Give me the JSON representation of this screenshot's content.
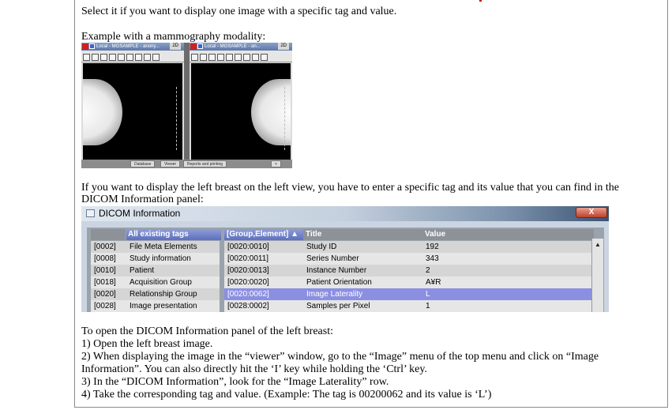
{
  "intro": "Select it if you want to display one image with a specific tag and value.",
  "example_label": "Example with a mammography modality:",
  "mammo_viewer": {
    "panes": [
      {
        "title": "Local - MGSAMPLE - anony...",
        "mode": "2D"
      },
      {
        "title": "Local - MGSAMPLE - an...",
        "mode": "2D"
      }
    ],
    "bottom_buttons": [
      "Database",
      "Viewer",
      "Reports and printing",
      "<"
    ]
  },
  "explain_lines": [
    "If you want to display the left breast on the left view, you have to enter a specific tag and its value that you can find in the",
    "DICOM Information panel:"
  ],
  "dicom": {
    "window_title": "DICOM Information",
    "close_label": "X",
    "left_header": "All existing tags",
    "left_rows": [
      {
        "code": "[0002]",
        "name": "File Meta Elements"
      },
      {
        "code": "[0008]",
        "name": "Study information"
      },
      {
        "code": "[0010]",
        "name": "Patient"
      },
      {
        "code": "[0018]",
        "name": "Acquisition Group"
      },
      {
        "code": "[0020]",
        "name": "Relationship Group"
      },
      {
        "code": "[0028]",
        "name": "Image presentation"
      }
    ],
    "right_headers": [
      "[Group,Element]",
      "Title",
      "Value"
    ],
    "right_rows": [
      {
        "tag": "[0020:0010]",
        "title": "Study ID",
        "value": "192",
        "selected": false
      },
      {
        "tag": "[0020:0011]",
        "title": "Series Number",
        "value": "343",
        "selected": false
      },
      {
        "tag": "[0020:0013]",
        "title": "Instance Number",
        "value": "2",
        "selected": false
      },
      {
        "tag": "[0020:0020]",
        "title": "Patient Orientation",
        "value": "A¥R",
        "selected": false
      },
      {
        "tag": "[0020:0062]",
        "title": "Image Laterality",
        "value": "L",
        "selected": true
      },
      {
        "tag": "[0028:0002]",
        "title": "Samples per Pixel",
        "value": "1",
        "selected": false
      }
    ]
  },
  "instructions": {
    "heading": "To open the DICOM Information panel of the left breast:",
    "steps": [
      "1) Open the left breast image.",
      "2) When displaying the image in the “viewer” window, go to the “Image” menu of the top menu and click on “Image",
      "Information”. You can also directly hit the ‘I’ key while holding the ‘Ctrl’ key.",
      "3) In the “DICOM Information”, look for the “Image Laterality” row.",
      "4) Take the corresponding tag and value. (Example: The tag is 00200062 and its value is ‘L’)"
    ]
  },
  "colors": {
    "selected_row": "#8b8fe2",
    "header_blue": "#5d6fbe",
    "close_red": "#c0402a",
    "accent_mark": "#d00000"
  }
}
